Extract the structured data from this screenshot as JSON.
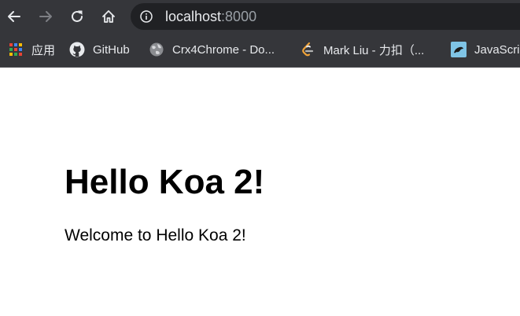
{
  "browser": {
    "url_host": "localhost",
    "url_port": ":8000",
    "icons": {
      "back": "back-arrow-icon",
      "forward": "forward-arrow-icon",
      "reload": "reload-icon",
      "home": "home-icon",
      "site_info": "info-icon"
    }
  },
  "bookmarks": [
    {
      "label": "应用",
      "icon": "apps-grid-icon"
    },
    {
      "label": "GitHub",
      "icon": "github-icon"
    },
    {
      "label": "Crx4Chrome - Do...",
      "icon": "globe-icon"
    },
    {
      "label": "Mark Liu - 力扣（...",
      "icon": "leetcode-icon"
    },
    {
      "label": "JavaScri",
      "icon": "javascript-icon"
    }
  ],
  "page": {
    "heading": "Hello Koa 2!",
    "paragraph": "Welcome to Hello Koa 2!"
  },
  "colors": {
    "toolbar_bg": "#35363a",
    "omnibox_bg": "#202124",
    "toolbar_text": "#e8eaed",
    "url_port_text": "#9aa0a6",
    "page_bg": "#ffffff"
  }
}
